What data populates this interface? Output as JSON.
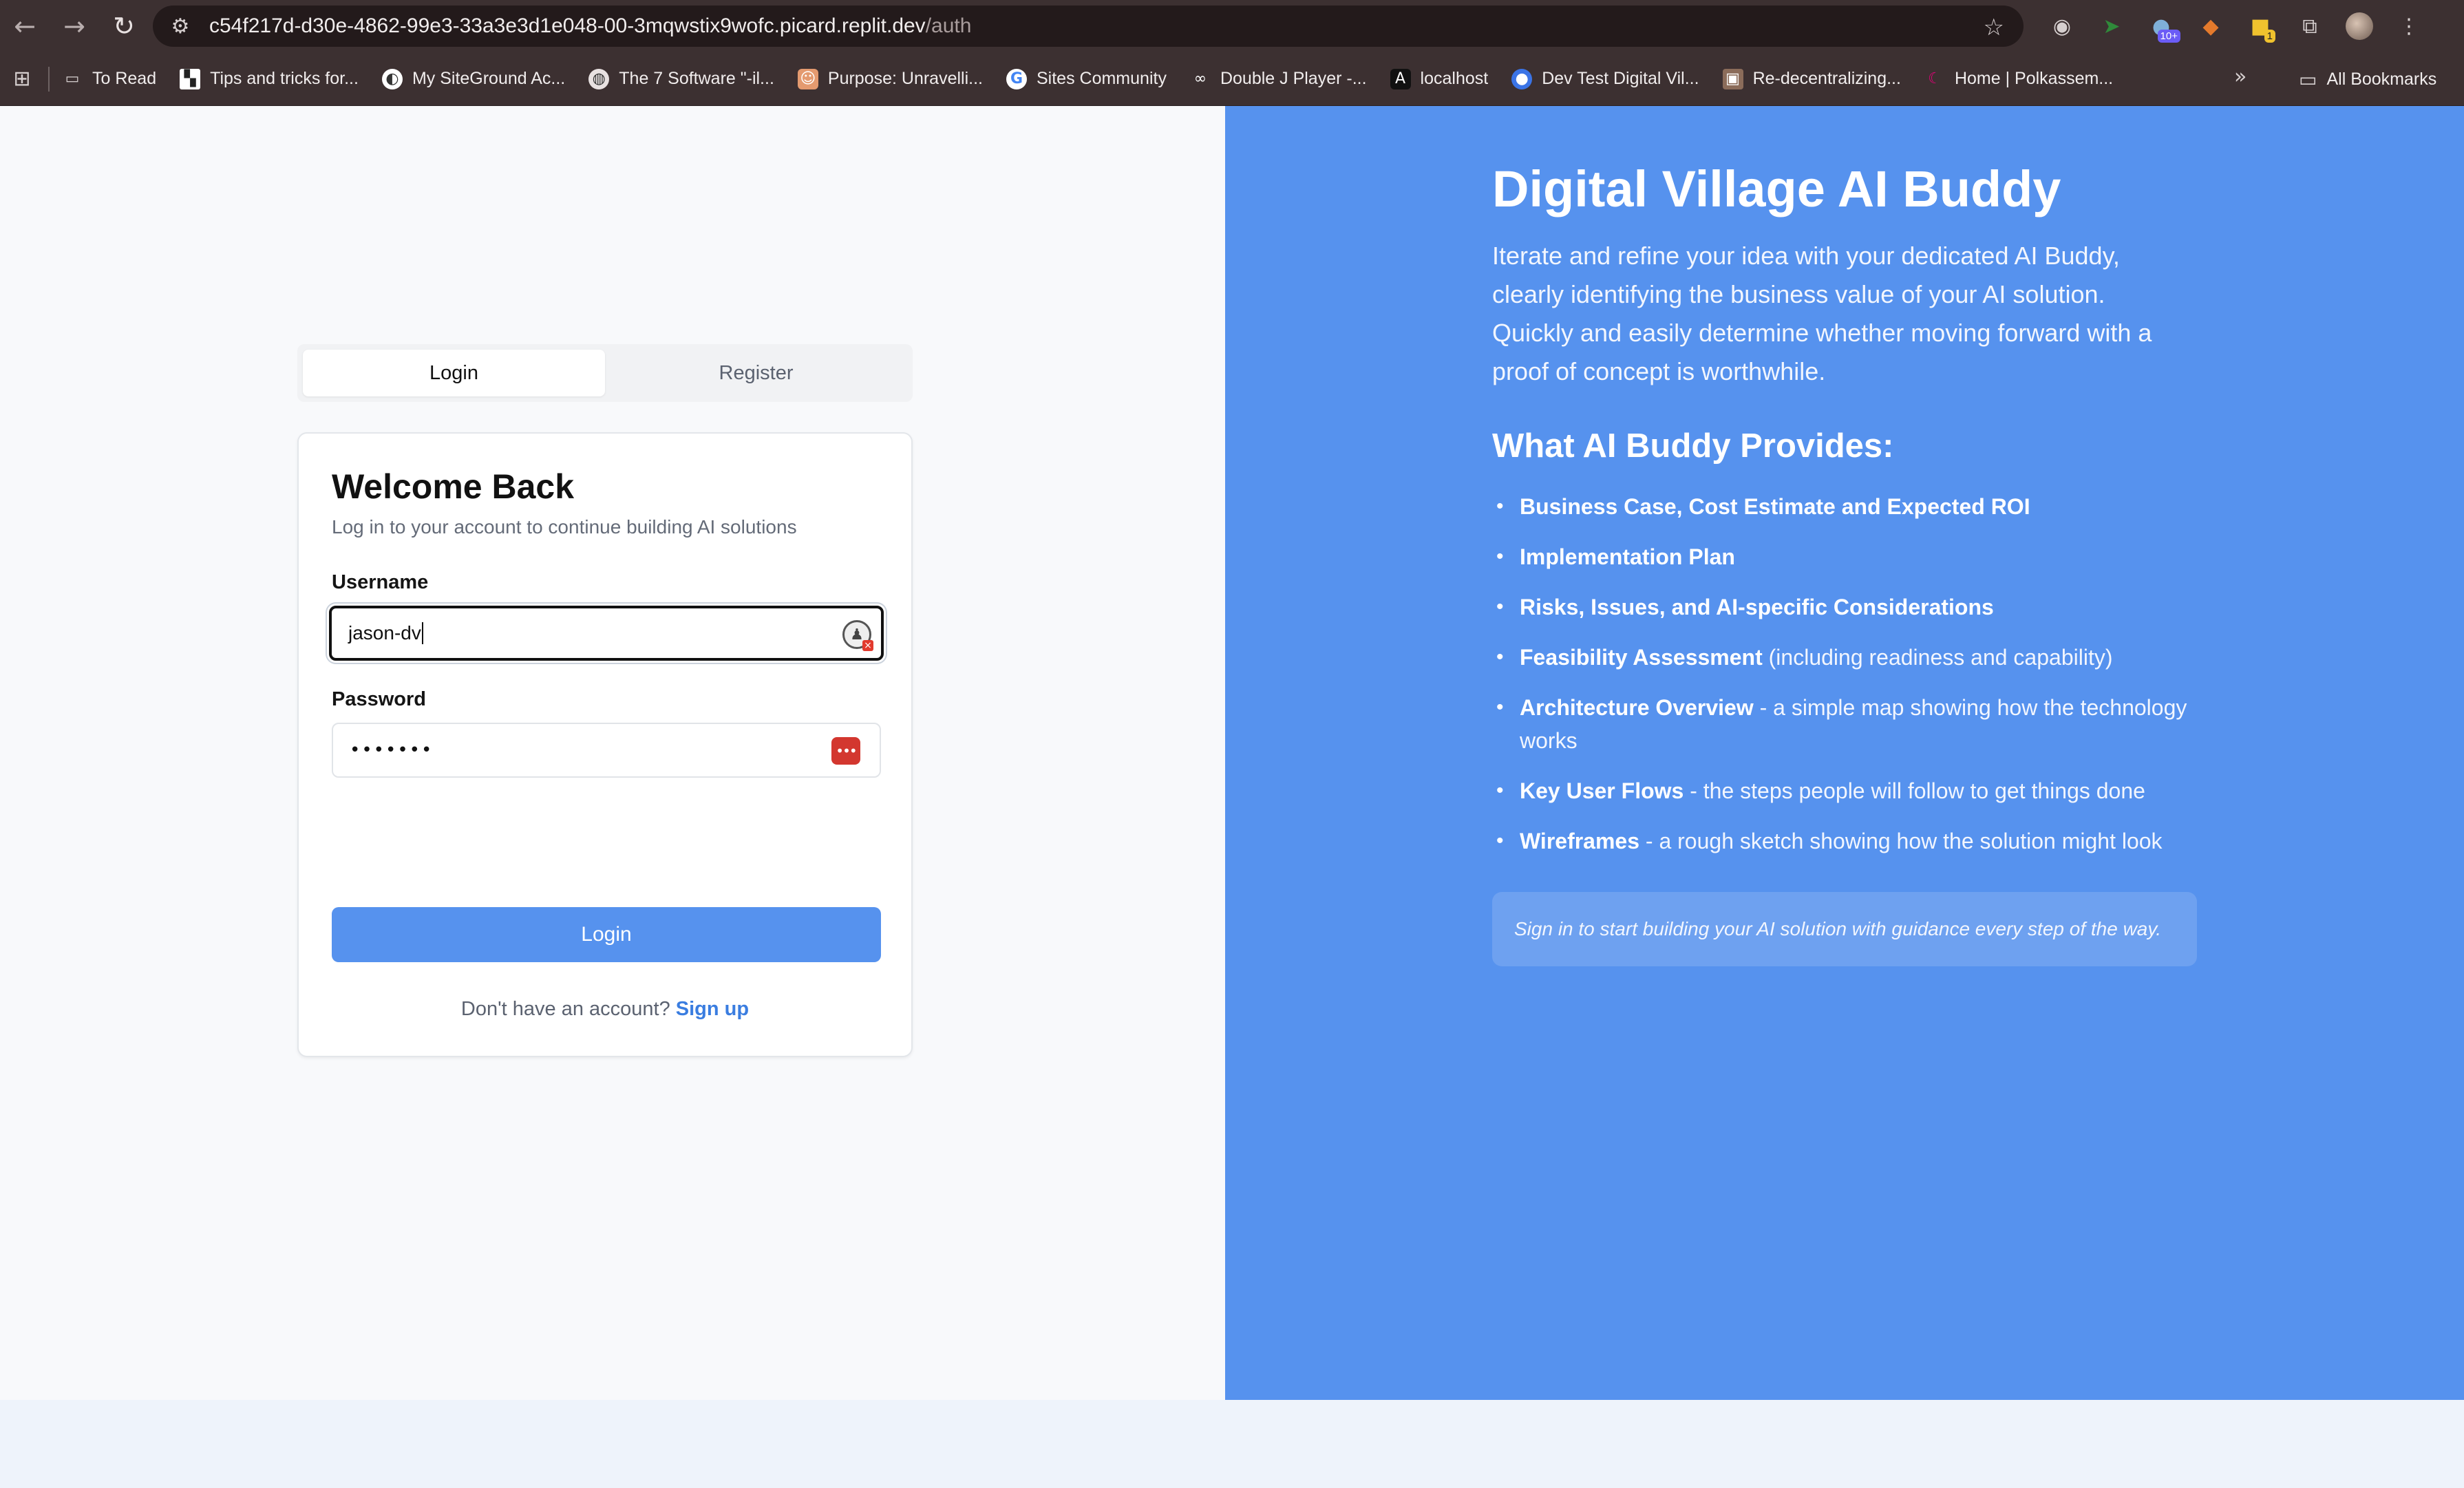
{
  "browser": {
    "url_host": "c54f217d-d30e-4862-99e3-33a3e3d1e048-00-3mqwstix9wofc.picard.replit.dev",
    "url_path": "/auth",
    "extension_badge": "10+",
    "sticky_badge": "1"
  },
  "bookmarks": {
    "items": [
      {
        "label": "To Read",
        "icon": "folder-icon"
      },
      {
        "label": "Tips and tricks for...",
        "icon": "tips-icon"
      },
      {
        "label": "My SiteGround Ac...",
        "icon": "siteground-icon"
      },
      {
        "label": "The 7 Software \"-il...",
        "icon": "globe-icon"
      },
      {
        "label": "Purpose: Unravelli...",
        "icon": "purpose-icon"
      },
      {
        "label": "Sites Community",
        "icon": "google-icon"
      },
      {
        "label": "Double J Player -...",
        "icon": "abc-icon"
      },
      {
        "label": "localhost",
        "icon": "localhost-icon"
      },
      {
        "label": "Dev Test Digital Vil...",
        "icon": "dev-test-icon"
      },
      {
        "label": "Re-decentralizing...",
        "icon": "article-icon"
      },
      {
        "label": "Home | Polkassem...",
        "icon": "polkassembly-icon"
      }
    ],
    "all_bookmarks": "All Bookmarks"
  },
  "auth": {
    "tabs": [
      {
        "label": "Login",
        "active": true
      },
      {
        "label": "Register",
        "active": false
      }
    ],
    "title": "Welcome Back",
    "subtitle": "Log in to your account to continue building AI solutions",
    "username_label": "Username",
    "username_value": "jason-dv",
    "password_label": "Password",
    "password_mask": "•••••••",
    "login_button": "Login",
    "signup_prompt": "Don't have an account?",
    "signup_link": "Sign up"
  },
  "hero": {
    "title": "Digital Village AI Buddy",
    "description": "Iterate and refine your idea with your dedicated AI Buddy, clearly identifying the business value of your AI solution. Quickly and easily determine whether moving forward with a proof of concept is worthwhile.",
    "provides_heading": "What AI Buddy Provides:",
    "features": [
      {
        "strong": "Business Case, Cost Estimate and Expected ROI",
        "rest": ""
      },
      {
        "strong": "Implementation Plan",
        "rest": ""
      },
      {
        "strong": "Risks, Issues, and AI-specific Considerations",
        "rest": ""
      },
      {
        "strong": "Feasibility Assessment",
        "rest": " (including readiness and capability)"
      },
      {
        "strong": "Architecture Overview",
        "rest": " - a simple map showing how the technology works"
      },
      {
        "strong": "Key User Flows",
        "rest": " - the steps people will follow to get things done"
      },
      {
        "strong": "Wireframes",
        "rest": " - a rough sketch showing how the solution might look"
      }
    ],
    "note": "Sign in to start building your AI solution with guidance every step of the way."
  },
  "colors": {
    "accent": "#5692ee",
    "link": "#3a7de0",
    "chrome": "#3c3031"
  }
}
